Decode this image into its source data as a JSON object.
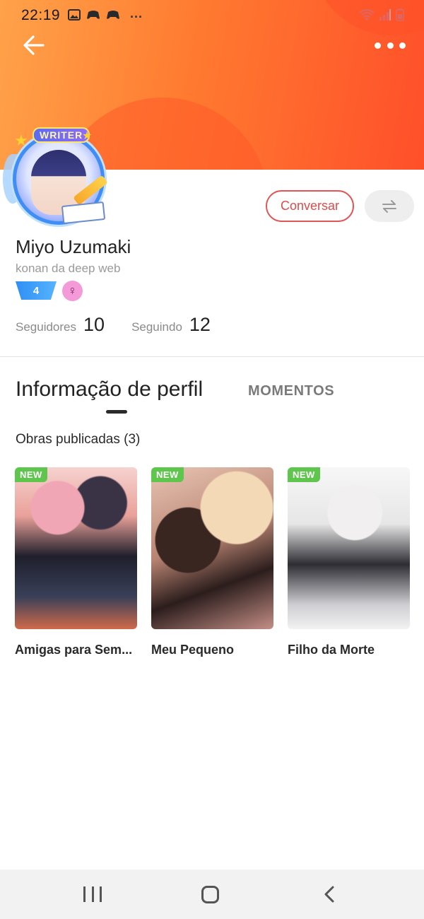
{
  "status_bar": {
    "time": "22:19",
    "left_icons": [
      "gallery-icon",
      "game-icon",
      "game-icon",
      "more-dots"
    ],
    "right_icons": [
      "wifi-icon",
      "signal-icon",
      "battery-icon"
    ]
  },
  "header": {
    "banner_colors": [
      "#ffa24a",
      "#ff4f2a"
    ],
    "back_icon": "arrow-left-icon",
    "more_icon": "more-horizontal-icon"
  },
  "avatar": {
    "frame_badge_text": "WRITER"
  },
  "actions": {
    "chat_label": "Conversar",
    "swap_icon": "swap-arrows-icon"
  },
  "profile": {
    "name": "Miyo Uzumaki",
    "bio": "konan da deep web",
    "level": "4",
    "gender_icon": "female-icon",
    "stats": {
      "followers_label": "Seguidores",
      "followers_value": "10",
      "following_label": "Seguindo",
      "following_value": "12"
    }
  },
  "tabs": {
    "active": "Informação de perfil",
    "other": "MOMENTOS"
  },
  "works_section": {
    "title": "Obras publicadas (3)",
    "items": [
      {
        "tag": "NEW",
        "title": "Amigas para Sem..."
      },
      {
        "tag": "NEW",
        "title": "Meu Pequeno"
      },
      {
        "tag": "NEW",
        "title": "Filho da Morte"
      }
    ]
  },
  "nav_bar": {
    "buttons": [
      "recent-apps-icon",
      "home-icon",
      "back-icon"
    ]
  },
  "colors": {
    "accent": "#e25555",
    "new_tag": "#5fc64d",
    "level_badge": "#2f8ef3",
    "gender_badge": "#f59ad9"
  }
}
